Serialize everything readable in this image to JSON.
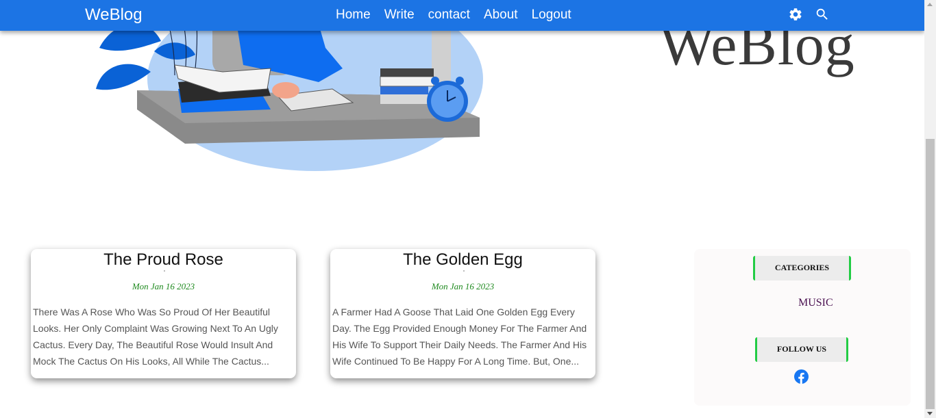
{
  "navbar": {
    "brand": "WeBlog",
    "links": [
      "Home",
      "Write",
      "contact",
      "About",
      "Logout"
    ],
    "icons": [
      "gear-icon",
      "search-icon"
    ]
  },
  "hero": {
    "title": "WeBlog",
    "illustration": "person-reading-at-desk-illustration"
  },
  "posts": [
    {
      "title": "The Proud Rose",
      "date": "Mon Jan 16 2023",
      "excerpt": "There Was A Rose Who Was So Proud Of Her Beautiful Looks. Her Only Complaint Was Growing Next To An Ugly Cactus. Every Day, The Beautiful Rose Would Insult And Mock The Cactus On His Looks, All While The Cactus..."
    },
    {
      "title": "The Golden Egg",
      "date": "Mon Jan 16 2023",
      "excerpt": "A Farmer Had A Goose That Laid One Golden Egg Every Day. The Egg Provided Enough Money For The Farmer And His Wife To Support Their Daily Needs. The Farmer And His Wife Continued To Be Happy For A Long Time. But, One..."
    }
  ],
  "sidebar": {
    "categories_heading": "CATEGORIES",
    "categories": [
      "MUSIC"
    ],
    "follow_heading": "FOLLOW US",
    "social_icons": [
      "facebook-icon"
    ]
  },
  "colors": {
    "nav_bg": "#1c74e4",
    "date_green": "#1f8a1f",
    "heading_border": "#22cc44",
    "category_text": "#4a1050",
    "facebook_blue": "#1877f2"
  }
}
